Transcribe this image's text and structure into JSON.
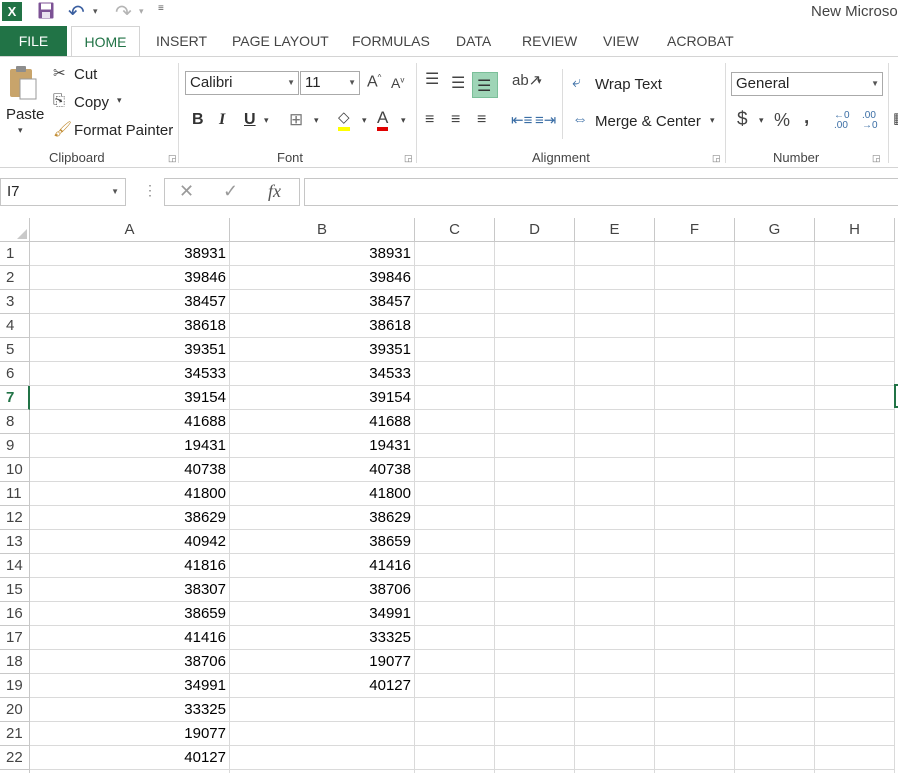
{
  "qat": {
    "app_icon": "excel-icon",
    "title": "New Microso"
  },
  "tabs": [
    "FILE",
    "HOME",
    "INSERT",
    "PAGE LAYOUT",
    "FORMULAS",
    "DATA",
    "REVIEW",
    "VIEW",
    "ACROBAT"
  ],
  "ribbon": {
    "clipboard": {
      "paste": "Paste",
      "cut": "Cut",
      "copy": "Copy",
      "format_painter": "Format Painter",
      "label": "Clipboard"
    },
    "font": {
      "name": "Calibri",
      "size": "11",
      "label": "Font"
    },
    "alignment": {
      "wrap_text": "Wrap Text",
      "merge_center": "Merge & Center",
      "label": "Alignment"
    },
    "number": {
      "format": "General",
      "label": "Number"
    }
  },
  "formula_bar": {
    "name_box": "I7",
    "fx": "fx",
    "value": ""
  },
  "grid": {
    "columns": [
      "A",
      "B",
      "C",
      "D",
      "E",
      "F",
      "G",
      "H"
    ],
    "active_row": 7,
    "rows": [
      {
        "n": "1",
        "a": "38931",
        "b": "38931"
      },
      {
        "n": "2",
        "a": "39846",
        "b": "39846"
      },
      {
        "n": "3",
        "a": "38457",
        "b": "38457"
      },
      {
        "n": "4",
        "a": "38618",
        "b": "38618"
      },
      {
        "n": "5",
        "a": "39351",
        "b": "39351"
      },
      {
        "n": "6",
        "a": "34533",
        "b": "34533"
      },
      {
        "n": "7",
        "a": "39154",
        "b": "39154"
      },
      {
        "n": "8",
        "a": "41688",
        "b": "41688"
      },
      {
        "n": "9",
        "a": "19431",
        "b": "19431"
      },
      {
        "n": "10",
        "a": "40738",
        "b": "40738"
      },
      {
        "n": "11",
        "a": "41800",
        "b": "41800"
      },
      {
        "n": "12",
        "a": "38629",
        "b": "38629"
      },
      {
        "n": "13",
        "a": "40942",
        "b": "38659"
      },
      {
        "n": "14",
        "a": "41816",
        "b": "41416"
      },
      {
        "n": "15",
        "a": "38307",
        "b": "38706"
      },
      {
        "n": "16",
        "a": "38659",
        "b": "34991"
      },
      {
        "n": "17",
        "a": "41416",
        "b": "33325"
      },
      {
        "n": "18",
        "a": "38706",
        "b": "19077"
      },
      {
        "n": "19",
        "a": "34991",
        "b": "40127"
      },
      {
        "n": "20",
        "a": "33325",
        "b": ""
      },
      {
        "n": "21",
        "a": "19077",
        "b": ""
      },
      {
        "n": "22",
        "a": "40127",
        "b": ""
      }
    ]
  },
  "colors": {
    "accent": "#217346"
  }
}
